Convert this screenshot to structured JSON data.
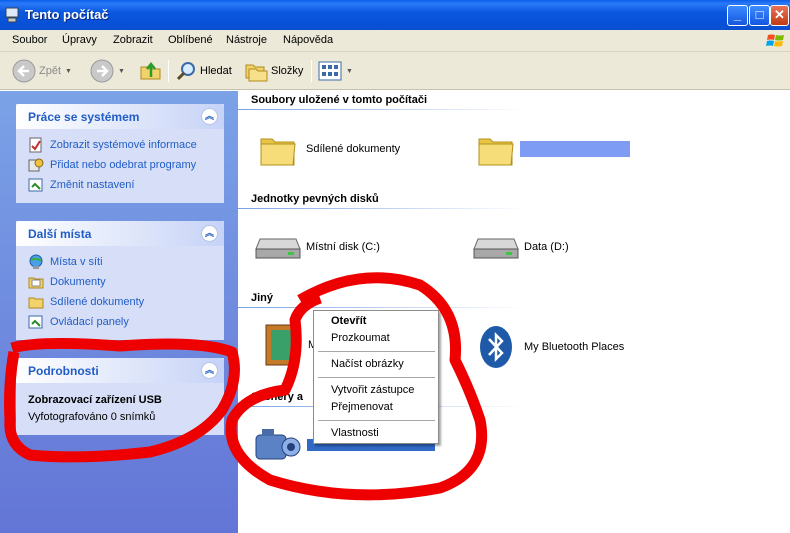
{
  "window": {
    "title": "Tento počítač"
  },
  "menu": [
    "Soubor",
    "Úpravy",
    "Zobrazit",
    "Oblíbené",
    "Nástroje",
    "Nápověda"
  ],
  "toolbar": {
    "back": "Zpět",
    "search": "Hledat",
    "folders": "Složky"
  },
  "left": {
    "system": {
      "title": "Práce se systémem",
      "items": [
        "Zobrazit systémové informace",
        "Přidat nebo odebrat programy",
        "Změnit nastavení"
      ]
    },
    "places": {
      "title": "Další místa",
      "items": [
        "Místa v síti",
        "Dokumenty",
        "Sdílené dokumenty",
        "Ovládací panely"
      ]
    },
    "details": {
      "title": "Podrobnosti",
      "name": "Zobrazovací zařízení USB",
      "info": "Vyfotografováno 0 snímků"
    }
  },
  "content": {
    "groups": {
      "stored": "Soubory uložené v tomto počítači",
      "drives": "Jednotky pevných disků",
      "other": "Jiný",
      "scanners": "Skenery a"
    },
    "items": {
      "shared_docs": "Sdílené dokumenty",
      "drive_c": "Místní disk (C:)",
      "drive_d": "Data (D:)",
      "other_partial": "M",
      "bluetooth": "My Bluetooth Places",
      "usb_device": "Zobrazovací zařízení USB"
    }
  },
  "context_menu": {
    "items": [
      "Otevřít",
      "Prozkoumat",
      "Načíst obrázky",
      "Vytvořit zástupce",
      "Přejmenovat",
      "Vlastnosti"
    ]
  },
  "colors": {
    "annotation": "#ee0000",
    "link": "#215dc6",
    "titlebar": "#0b58df"
  }
}
